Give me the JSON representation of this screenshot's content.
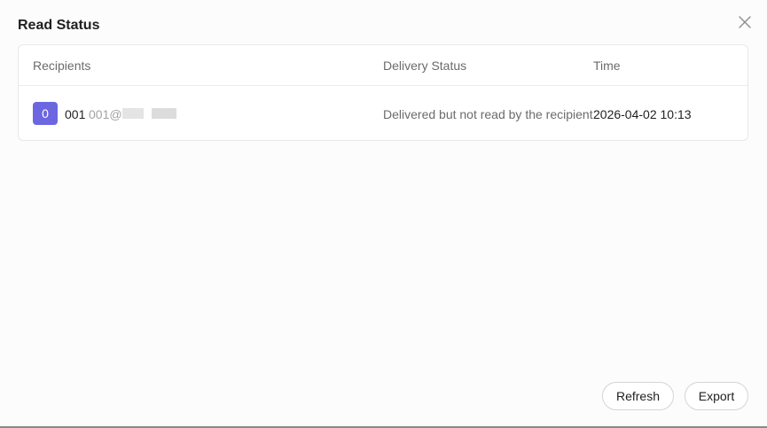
{
  "dialog": {
    "title": "Read Status",
    "close_icon": "close-icon"
  },
  "table": {
    "headers": {
      "recipients": "Recipients",
      "delivery_status": "Delivery Status",
      "time": "Time"
    },
    "rows": [
      {
        "avatar": "0",
        "name": "001",
        "email": "001@",
        "delivery_status": "Delivered but not read by the recipient",
        "time": "2026-04-02 10:13"
      }
    ]
  },
  "footer": {
    "refresh_label": "Refresh",
    "export_label": "Export"
  },
  "colors": {
    "avatar_bg": "#6c67e0",
    "header_text": "#6b6b6b",
    "body_text": "#1f1f1f"
  }
}
